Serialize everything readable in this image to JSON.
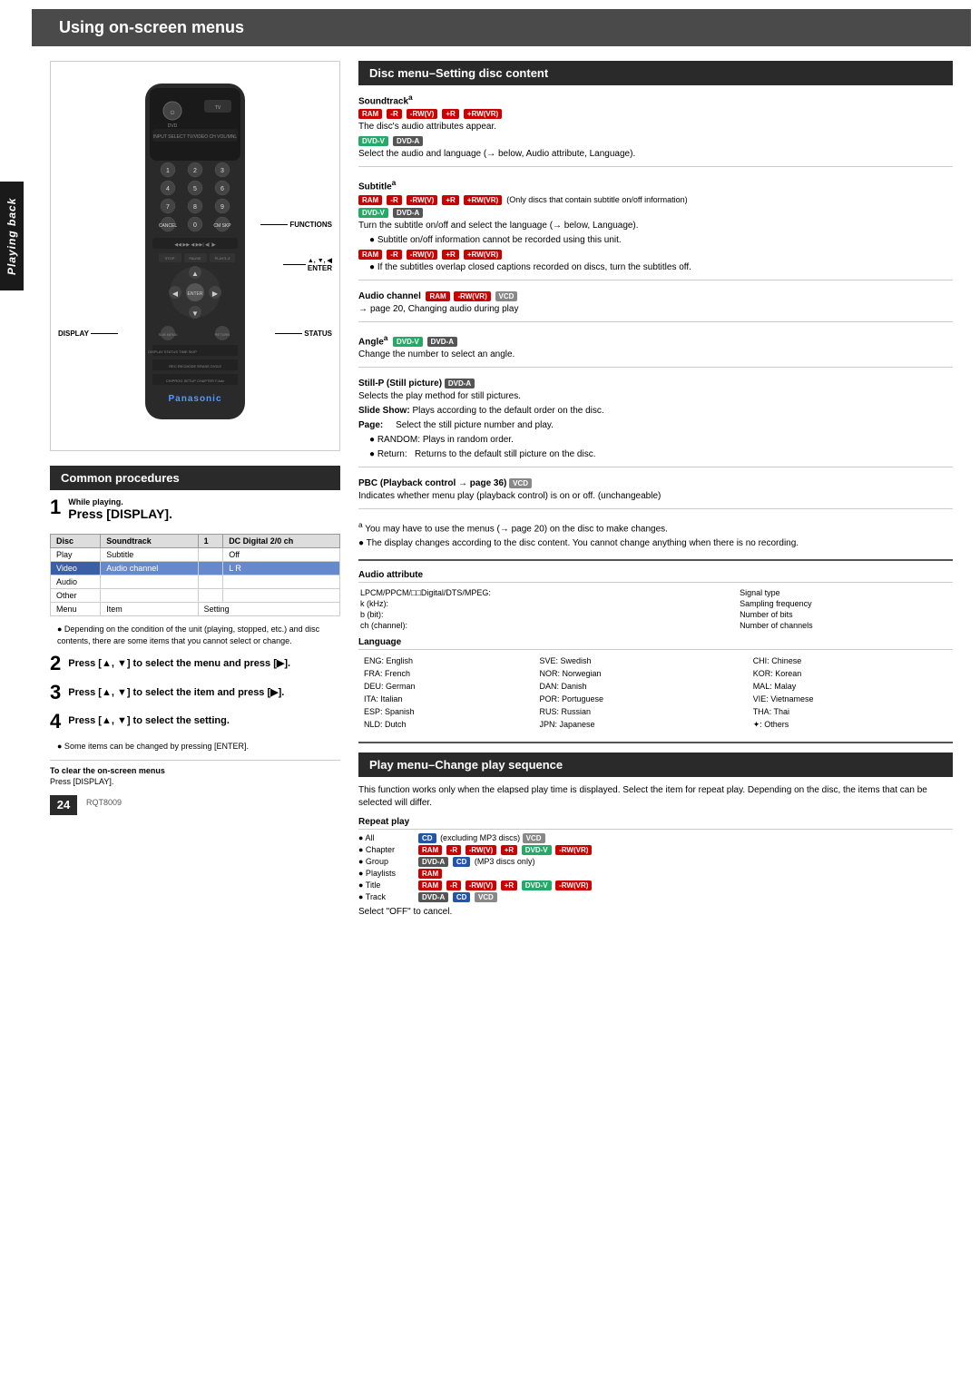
{
  "page": {
    "title": "Using on-screen menus",
    "model": "RQT8009",
    "page_number": "24",
    "side_tab": "Playing back"
  },
  "common_procedures": {
    "header": "Common procedures",
    "step1": {
      "number": "1",
      "label": "While playing.",
      "title": "Press [DISPLAY]."
    },
    "step2": {
      "number": "2",
      "instruction": "Press [▲, ▼] to select the menu and press [▶]."
    },
    "step3": {
      "number": "3",
      "instruction": "Press [▲, ▼] to select the item and press [▶]."
    },
    "step4": {
      "number": "4",
      "instruction": "Press [▲, ▼] to select the setting."
    },
    "note": "● Some items can be changed by pressing [ENTER].",
    "clear_label": "To clear the on-screen menus",
    "clear_text": "Press [DISPLAY].",
    "conditions_note": "● Depending on the condition of the unit (playing, stopped, etc.) and disc contents, there are some items that you cannot select or change."
  },
  "menu_table": {
    "columns": [
      "Disc",
      "Soundtrack",
      "1",
      "DC Digital 2/0 ch"
    ],
    "rows": [
      {
        "menu": "Play",
        "item": "Subtitle",
        "setting": "Off"
      },
      {
        "menu": "Video",
        "item": "Audio channel",
        "setting": "L R"
      },
      {
        "menu": "Audio",
        "item": "",
        "setting": ""
      },
      {
        "menu": "Other",
        "item": "",
        "setting": ""
      }
    ],
    "footer": [
      "Menu",
      "Item",
      "Setting"
    ]
  },
  "disc_menu": {
    "header": "Disc menu–Setting disc content",
    "soundtrack": {
      "label": "Soundtrack",
      "note_marker": "a",
      "badges": [
        "RAM",
        "-R",
        "-RW(V)",
        "+R",
        "+RW(VR)"
      ],
      "text1": "The disc's audio attributes appear.",
      "badges2": [
        "DVD-V",
        "DVD-A"
      ],
      "text2": "Select the audio and language (→ below, Audio attribute, Language)."
    },
    "subtitle": {
      "label": "Subtitle",
      "note_marker": "a",
      "badges": [
        "RAM",
        "-R",
        "-RW(V)",
        "+R",
        "+RW(VR)"
      ],
      "note": "(Only discs that contain subtitle on/off information)",
      "badges2": [
        "DVD-V",
        "DVD-A"
      ],
      "text1": "Turn the subtitle on/off and select the language (→ below, Language).",
      "bullet1": "● Subtitle on/off information cannot be recorded using this unit.",
      "badges3": [
        "RAM",
        "-R",
        "-RW(V)",
        "+R",
        "+RW(VR)"
      ],
      "bullet2": "● If the subtitles overlap closed captions recorded on discs, turn the subtitles off."
    },
    "audio_channel": {
      "label": "Audio channel",
      "badges": [
        "RAM",
        "-RW(VR)",
        "VCD"
      ],
      "arrow_text": "→ page 20, Changing audio during play"
    },
    "angle": {
      "label": "Angle",
      "note_marker": "a",
      "badges": [
        "DVD-V",
        "DVD-A"
      ],
      "text": "Change the number to select an angle."
    },
    "still_p": {
      "label": "Still-P (Still picture)",
      "badges": [
        "DVD-A"
      ],
      "text_intro": "Selects the play method for still pictures.",
      "slide_show": "Slide Show: Plays according to the default order on the disc.",
      "page_text": "Page:     Select the still picture number and play.",
      "random": "● RANDOM: Plays in random order.",
      "return": "● Return:   Returns to the default still picture on the disc."
    },
    "pbc": {
      "label": "PBC (Playback control → page 36)",
      "badges": [
        "VCD"
      ],
      "text": "Indicates whether menu play (playback control) is on or off. (unchangeable)"
    },
    "footnote_a": "a You may have to use the menus (→ page 20) on the disc to make changes.",
    "footnote_b": "● The display changes according to the disc content. You cannot change anything when there is no recording.",
    "audio_attribute": {
      "header": "Audio attribute",
      "rows": [
        {
          "label": "LPCM/PPCM/□□Digital/DTS/MPEG:",
          "value": "Signal type"
        },
        {
          "label": "k (kHz):",
          "value": "Sampling frequency"
        },
        {
          "label": "b (bit):",
          "value": "Number of bits"
        },
        {
          "label": "ch (channel):",
          "value": "Number of channels"
        }
      ]
    },
    "language": {
      "header": "Language",
      "entries": [
        {
          "code": "ENG:",
          "lang": "English",
          "code2": "SVE:",
          "lang2": "Swedish",
          "code3": "CHI:",
          "lang3": "Chinese"
        },
        {
          "code": "FRA:",
          "lang": "French",
          "code2": "NOR:",
          "lang2": "Norwegian",
          "code3": "KOR:",
          "lang3": "Korean"
        },
        {
          "code": "DEU:",
          "lang": "German",
          "code2": "DAN:",
          "lang2": "Danish",
          "code3": "MAL:",
          "lang3": "Malay"
        },
        {
          "code": "ITA:",
          "lang": "Italian",
          "code2": "POR:",
          "lang2": "Portuguese",
          "code3": "VIE:",
          "lang3": "Vietnamese"
        },
        {
          "code": "ESP:",
          "lang": "Spanish",
          "code2": "RUS:",
          "lang2": "Russian",
          "code3": "THA:",
          "lang3": "Thai"
        },
        {
          "code": "NLD:",
          "lang": "Dutch",
          "code2": "JPN:",
          "lang2": "Japanese",
          "code3": "✦:",
          "lang3": "Others"
        }
      ]
    }
  },
  "play_menu": {
    "header": "Play menu–Change play sequence",
    "intro": "This function works only when the elapsed play time is displayed. Select the item for repeat play. Depending on the disc, the items that can be selected will differ.",
    "repeat_play": {
      "header": "Repeat play",
      "items": [
        {
          "bullet": "● All",
          "badges": [
            "CD"
          ],
          "note": "(excluding MP3 discs)",
          "badges2": [
            "VCD"
          ]
        },
        {
          "bullet": "● Chapter",
          "badges": [
            "RAM",
            "-R",
            "-RW(V)",
            "+R",
            "DVD-V",
            "-RW(VR)"
          ]
        },
        {
          "bullet": "● Group",
          "badges": [
            "DVD-A",
            "CD"
          ],
          "note": "(MP3 discs only)"
        },
        {
          "bullet": "● Playlists",
          "badges": [
            "RAM"
          ]
        },
        {
          "bullet": "● Title",
          "badges": [
            "RAM",
            "-R",
            "-RW(V)",
            "+R",
            "DVD-V",
            "-RW(VR)"
          ]
        },
        {
          "bullet": "● Track",
          "badges": [
            "DVD-A",
            "CD",
            "VCD"
          ]
        }
      ],
      "cancel": "Select \"OFF\" to cancel."
    }
  },
  "annotations": {
    "functions": "FUNCTIONS",
    "enter": "▲, ▼, ◀",
    "enter_label": "ENTER",
    "display": "DISPLAY",
    "status": "STATUS"
  }
}
